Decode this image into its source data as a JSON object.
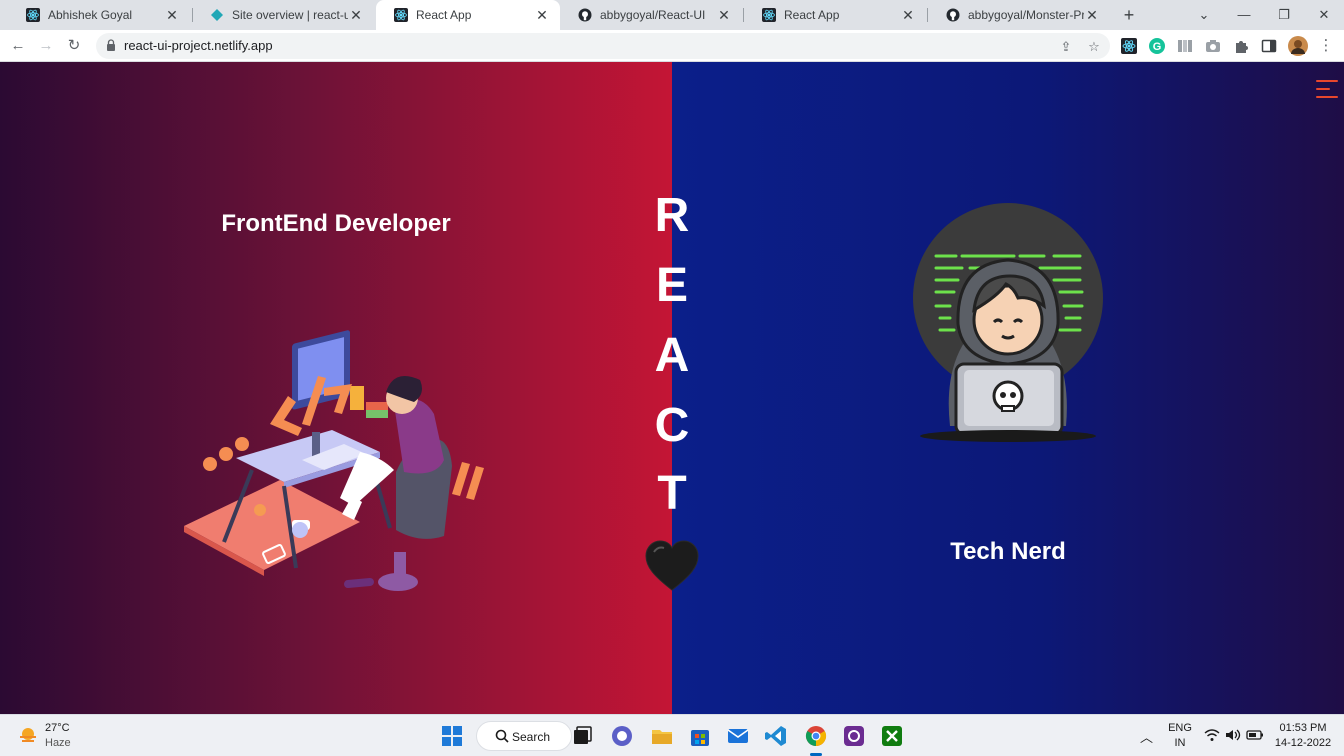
{
  "browser": {
    "tabs": [
      {
        "title": "Abhishek Goyal",
        "icon": "react-icon",
        "active": false
      },
      {
        "title": "Site overview | react-ui-proj",
        "icon": "netlify-icon",
        "active": false
      },
      {
        "title": "React App",
        "icon": "react-icon",
        "active": true
      },
      {
        "title": "abbygoyal/React-UI",
        "icon": "github-icon",
        "active": false
      },
      {
        "title": "React App",
        "icon": "react-icon",
        "active": false
      },
      {
        "title": "abbygoyal/Monster-Project",
        "icon": "github-icon",
        "active": false
      }
    ],
    "url": "react-ui-project.netlify.app"
  },
  "page": {
    "left_title": "FrontEnd Developer",
    "right_title": "Tech Nerd",
    "react_letters": [
      "R",
      "E",
      "A",
      "C",
      "T"
    ],
    "colors": {
      "left_gradient": [
        "#2b0a33",
        "#c41535"
      ],
      "right_gradient": [
        "#0b1f8a",
        "#1f0d46"
      ],
      "menu_accent": "#e8472d"
    }
  },
  "taskbar": {
    "weather_temp": "27°C",
    "weather_condition": "Haze",
    "search_label": "Search",
    "language_top": "ENG",
    "language_bottom": "IN",
    "time": "01:53 PM",
    "date": "14-12-2022"
  }
}
